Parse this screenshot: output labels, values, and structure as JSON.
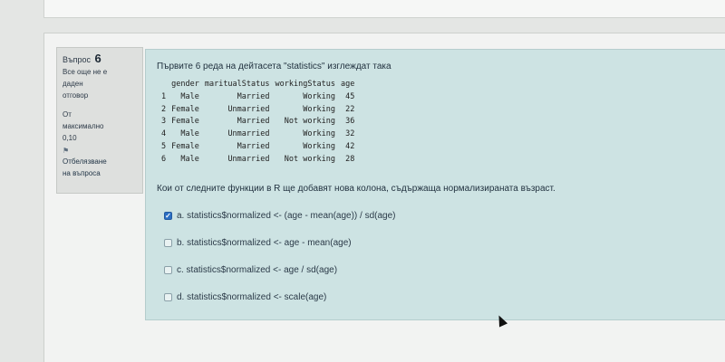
{
  "sidebar": {
    "question_label": "Въпрос",
    "question_number": "6",
    "status_line1": "Все още не е",
    "status_line2": "даден",
    "status_line3": "отговор",
    "marks_line1": "От",
    "marks_line2": "максимално",
    "marks_line3": "0,10",
    "flag_icon": "flag-icon",
    "flag_line1": "Отбелязване",
    "flag_line2": "на въпроса"
  },
  "question": {
    "intro": "Първите 6 реда на дейтасета \"statistics\" изглеждат така",
    "prompt": "Кои от следните функции в R ще добавят нова колона, съдържаща нормализираната възраст.",
    "table": {
      "headers": [
        "gender",
        "maritualStatus",
        "workingStatus",
        "age"
      ],
      "rows": [
        [
          "1",
          "Male",
          "Married",
          "Working",
          "45"
        ],
        [
          "2",
          "Female",
          "Unmarried",
          "Working",
          "22"
        ],
        [
          "3",
          "Female",
          "Married",
          "Not working",
          "36"
        ],
        [
          "4",
          "Male",
          "Unmarried",
          "Working",
          "32"
        ],
        [
          "5",
          "Female",
          "Married",
          "Working",
          "42"
        ],
        [
          "6",
          "Male",
          "Unmarried",
          "Not working",
          "28"
        ]
      ]
    },
    "options": [
      {
        "label": "a. statistics$normalized <- (age - mean(age)) / sd(age)",
        "checked": true
      },
      {
        "label": "b. statistics$normalized <- age - mean(age)",
        "checked": false
      },
      {
        "label": "c. statistics$normalized <- age / sd(age)",
        "checked": false
      },
      {
        "label": "d. statistics$normalized <- scale(age)",
        "checked": false
      }
    ]
  },
  "colors": {
    "content_bg": "#cde3e3",
    "checked": "#2b6fc4"
  }
}
